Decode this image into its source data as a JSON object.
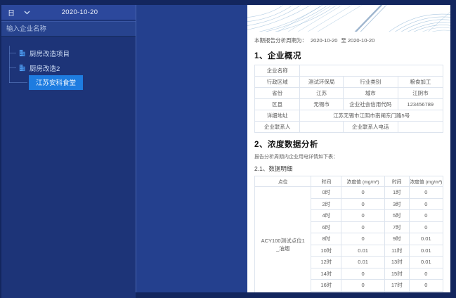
{
  "sidebar": {
    "granularity": {
      "label": "日"
    },
    "date": "2020-10-20",
    "search_placeholder": "输入企业名称",
    "tree": {
      "items": [
        {
          "label": "厨房改造项目",
          "selected": false
        },
        {
          "label": "厨房改造2",
          "selected": false
        },
        {
          "label": "江苏安科食堂",
          "selected": true
        }
      ]
    }
  },
  "report": {
    "period": {
      "prefix": "本期报告分析周期为：",
      "start": "2020-10-20",
      "separator": "至",
      "end": "2020-10-20"
    },
    "section1": {
      "title": "1、企业概况",
      "table_rows": [
        [
          {
            "t": "企业名称"
          },
          {
            "t": "",
            "c": 3
          }
        ],
        [
          {
            "t": "行政区域"
          },
          {
            "t": "测试环保局"
          },
          {
            "t": "行业类别"
          },
          {
            "t": "粮食加工"
          }
        ],
        [
          {
            "t": "省份"
          },
          {
            "t": "江苏"
          },
          {
            "t": "城市"
          },
          {
            "t": "江阴市"
          }
        ],
        [
          {
            "t": "区县"
          },
          {
            "t": "无锡市"
          },
          {
            "t": "企业社会信用代码"
          },
          {
            "t": "123456789"
          }
        ],
        [
          {
            "t": "详细地址"
          },
          {
            "t": "江苏无锡市江阴市南闸东门路5号",
            "c": 3
          }
        ],
        [
          {
            "t": "企业联系人"
          },
          {
            "t": ""
          },
          {
            "t": "企业联系人电话"
          },
          {
            "t": ""
          }
        ]
      ]
    },
    "section2": {
      "title": "2、浓度数据分析",
      "description": "报告分析周期内企业用电详情如下表：",
      "subtitle": "2.1、数据明细",
      "table": {
        "headers": [
          "点位",
          "时间",
          "浓度值 (mg/m³)",
          "时间",
          "浓度值 (mg/m³)"
        ],
        "point_label": "ACY100测试点位1_油烟",
        "rows": [
          [
            "0时",
            "0",
            "1时",
            "0"
          ],
          [
            "2时",
            "0",
            "3时",
            "0"
          ],
          [
            "4时",
            "0",
            "5时",
            "0"
          ],
          [
            "6时",
            "0",
            "7时",
            "0"
          ],
          [
            "8时",
            "0",
            "9时",
            "0.01"
          ],
          [
            "10时",
            "0.01",
            "11时",
            "0.01"
          ],
          [
            "12时",
            "0.01",
            "13时",
            "0.01"
          ],
          [
            "14时",
            "0",
            "15时",
            "0"
          ],
          [
            "16时",
            "0",
            "17时",
            "0"
          ],
          [
            "",
            "",
            "",
            ""
          ]
        ]
      }
    }
  },
  "colors": {
    "page_bg": "#13265e",
    "sidebar_bg": "#1d3478",
    "topbar_bg": "#2c489c",
    "content_bg": "#24408e",
    "selected_item_bg": "#1e7ce0",
    "building_icon": "#4f9cf0",
    "table_border": "#dde4ee"
  }
}
